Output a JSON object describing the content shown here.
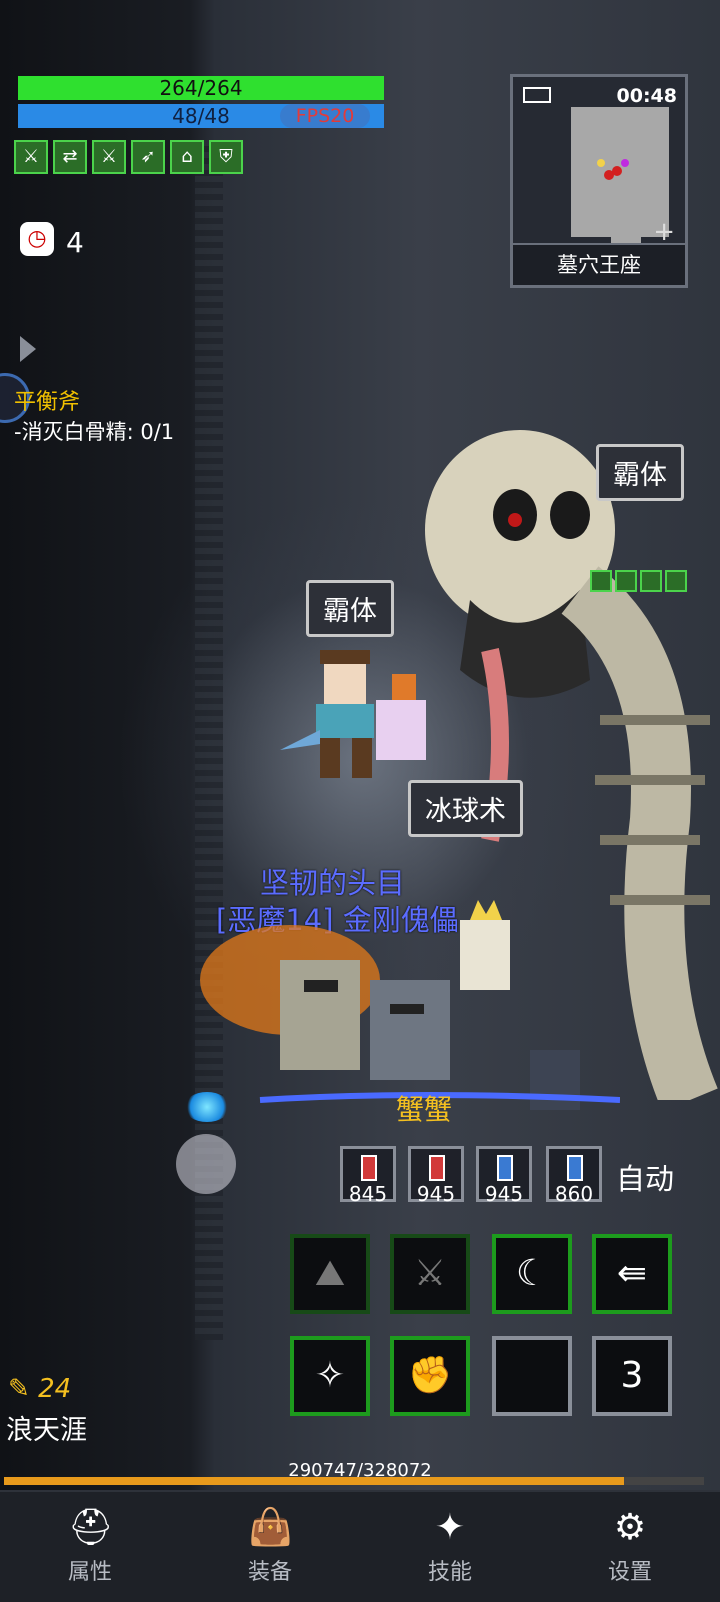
{
  "status": {
    "hp": "264/264",
    "mp": "48/48",
    "fps": "FPS20",
    "timer_count": "4"
  },
  "buffs": [
    "sword-buff",
    "swap-buff",
    "sword-buff",
    "sword-arrow-buff",
    "dome-buff",
    "shield-buff"
  ],
  "quest": {
    "title": "平衡斧",
    "line": "-消灭白骨精: 0/1"
  },
  "minimap": {
    "time": "00:48",
    "location": "墓穴王座"
  },
  "scene": {
    "tag_top_right": "霸体",
    "tag_player": "霸体",
    "tag_spell": "冰球术",
    "boss_title": "坚韧的头目",
    "boss_name": "[恶魔14] 金刚傀儡",
    "pet_name": "蟹蟹"
  },
  "potions": [
    {
      "count": "845",
      "color": "#d23a3a"
    },
    {
      "count": "945",
      "color": "#d23a3a"
    },
    {
      "count": "945",
      "color": "#3a7ad2"
    },
    {
      "count": "860",
      "color": "#3a7ad2"
    }
  ],
  "auto_label": "自动",
  "skills_row1": [
    {
      "icon": "hood-icon",
      "glyph": "⛰",
      "state": "dim"
    },
    {
      "icon": "blade-icon",
      "glyph": "⚔",
      "state": "dim"
    },
    {
      "icon": "slash-icon",
      "glyph": "☾",
      "state": "active"
    },
    {
      "icon": "arrow-burst-icon",
      "glyph": "⇚",
      "state": "active"
    }
  ],
  "skills_row2": [
    {
      "icon": "sparkle-icon",
      "glyph": "✧",
      "state": "active"
    },
    {
      "icon": "fist-icon",
      "glyph": "✊",
      "state": "active"
    },
    {
      "icon": "empty-slot",
      "glyph": "",
      "state": "empty"
    },
    {
      "icon": "page-number",
      "glyph": "3",
      "state": "num"
    }
  ],
  "player": {
    "level": "24",
    "name": "浪天涯",
    "xp_text": "290747/328072",
    "xp_fraction": 0.886
  },
  "nav": [
    {
      "label": "属性",
      "icon": "helmet-icon",
      "glyph": "⛑"
    },
    {
      "label": "装备",
      "icon": "bag-icon",
      "glyph": "👜"
    },
    {
      "label": "技能",
      "icon": "skill-crystal-icon",
      "glyph": "✦"
    },
    {
      "label": "设置",
      "icon": "gear-icon",
      "glyph": "⚙"
    }
  ]
}
